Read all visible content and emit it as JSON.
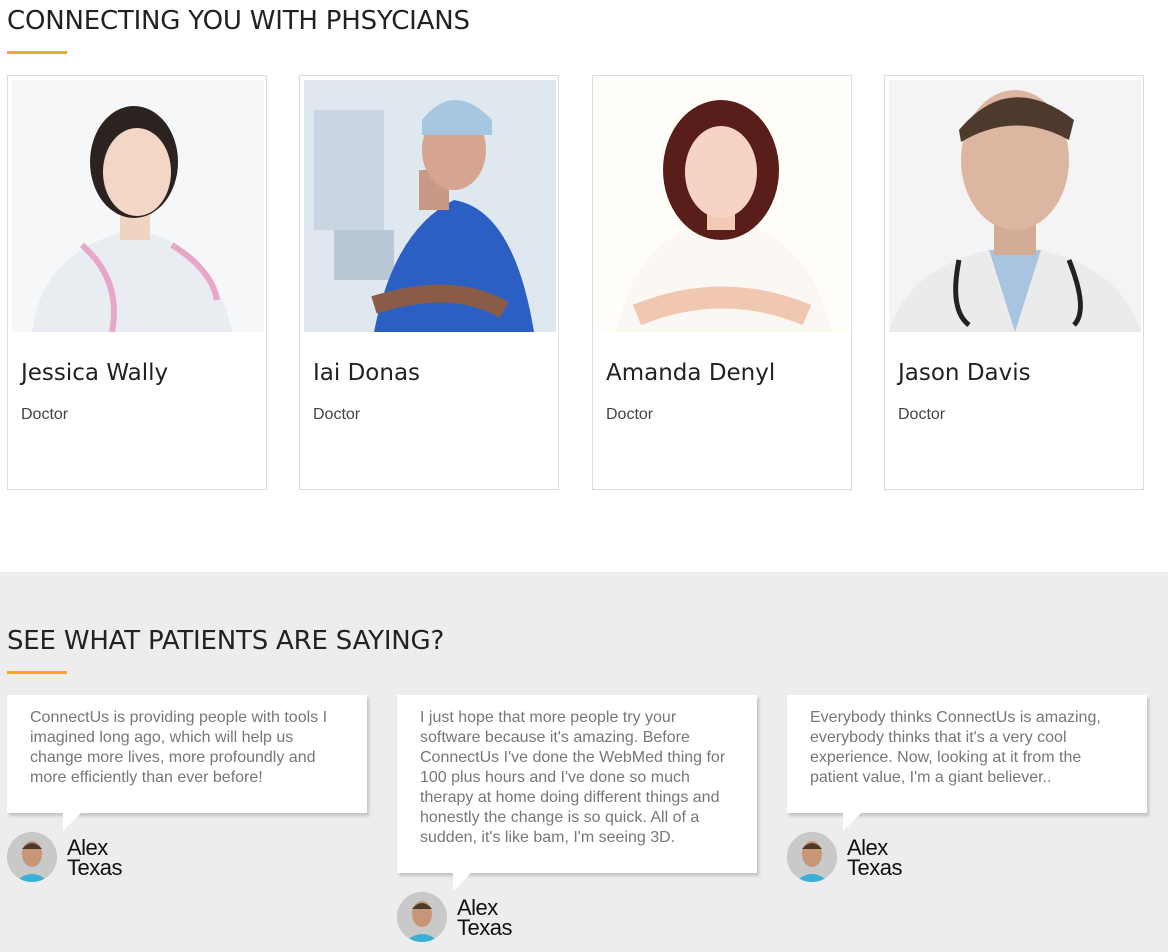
{
  "physicians": {
    "title": "CONNECTING YOU WITH PHSYCIANS",
    "doctors": [
      {
        "name": "Jessica Wally",
        "role": "Doctor"
      },
      {
        "name": "Iai Donas",
        "role": "Doctor"
      },
      {
        "name": "Amanda Denyl",
        "role": "Doctor"
      },
      {
        "name": "Jason Davis",
        "role": "Doctor"
      }
    ]
  },
  "testimonials": {
    "title": "SEE WHAT PATIENTS ARE SAYING?",
    "items": [
      {
        "quote": "ConnectUs is providing people with tools I imagined long ago, which will help us change more lives, more profoundly and more efficiently than ever before!",
        "author": "Alex",
        "location": "Texas"
      },
      {
        "quote": "I just hope that more people try your software because it's amazing. Before ConnectUs I've done the WebMed thing for 100 plus hours and I've done so much therapy at home doing different things and honestly the change is so quick. All of a sudden, it's like bam, I'm seeing 3D.",
        "author": "Alex",
        "location": "Texas"
      },
      {
        "quote": "Everybody thinks ConnectUs is amazing, everybody thinks that it's a very cool experience. Now, looking at it from the patient value, I'm a giant believer..",
        "author": "Alex",
        "location": "Texas"
      }
    ]
  },
  "colors": {
    "accent": "#f5a623",
    "testimonial_bg": "#ededed"
  }
}
